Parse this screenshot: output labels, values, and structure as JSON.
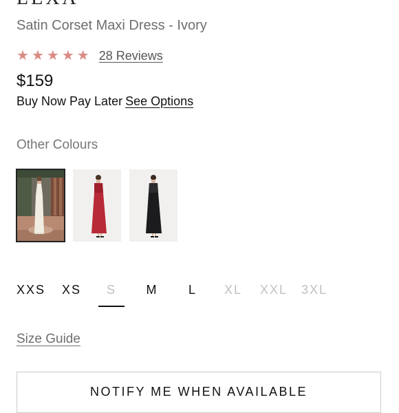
{
  "brand": {
    "name": "LEXA"
  },
  "product": {
    "name": "Satin Corset Maxi Dress - Ivory",
    "rating": 5,
    "max_rating": 5,
    "reviews_label": "28 Reviews",
    "price": "$159",
    "bnpl_text": "Buy Now Pay Later",
    "bnpl_link": "See Options"
  },
  "colours": {
    "heading": "Other Colours",
    "swatches": [
      {
        "name": "ivory",
        "selected": true
      },
      {
        "name": "red",
        "selected": false
      },
      {
        "name": "black",
        "selected": false
      }
    ]
  },
  "sizes": [
    {
      "label": "XXS",
      "available": true,
      "selected": false
    },
    {
      "label": "XS",
      "available": true,
      "selected": false
    },
    {
      "label": "S",
      "available": false,
      "selected": true
    },
    {
      "label": "M",
      "available": true,
      "selected": false
    },
    {
      "label": "L",
      "available": true,
      "selected": false
    },
    {
      "label": "XL",
      "available": false,
      "selected": false
    },
    {
      "label": "XXL",
      "available": false,
      "selected": false
    },
    {
      "label": "3XL",
      "available": false,
      "selected": false
    }
  ],
  "size_guide_label": "Size Guide",
  "notify_label": "NOTIFY ME WHEN AVAILABLE",
  "colors": {
    "star": "#d98c84",
    "muted": "#c0c0c0",
    "text": "#111111"
  }
}
